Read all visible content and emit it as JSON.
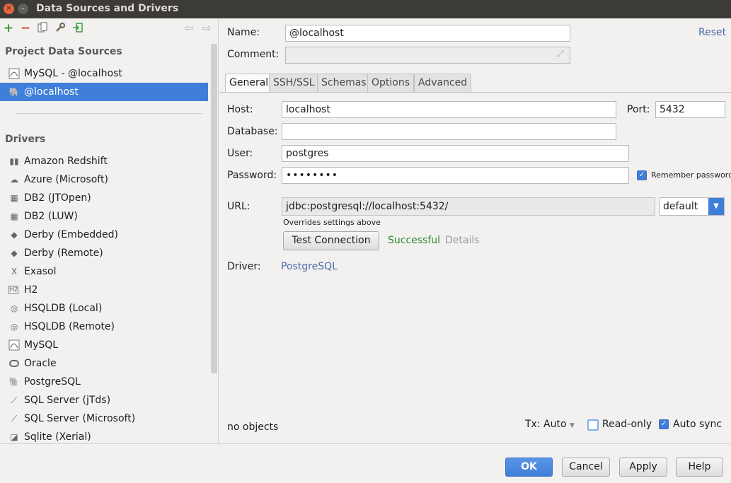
{
  "window": {
    "title": "Data Sources and Drivers"
  },
  "left": {
    "project_section": "Project Data Sources",
    "project_items": [
      {
        "label": "MySQL - @localhost",
        "icon": "mysql-icon"
      },
      {
        "label": "@localhost",
        "icon": "postgresql-icon",
        "selected": true
      }
    ],
    "drivers_section": "Drivers",
    "drivers": [
      {
        "label": "Amazon Redshift",
        "icon": "redshift-icon"
      },
      {
        "label": "Azure (Microsoft)",
        "icon": "azure-icon"
      },
      {
        "label": "DB2 (JTOpen)",
        "icon": "db2-icon"
      },
      {
        "label": "DB2 (LUW)",
        "icon": "db2-icon"
      },
      {
        "label": "Derby (Embedded)",
        "icon": "derby-icon"
      },
      {
        "label": "Derby (Remote)",
        "icon": "derby-icon"
      },
      {
        "label": "Exasol",
        "icon": "exasol-icon"
      },
      {
        "label": "H2",
        "icon": "h2-icon"
      },
      {
        "label": "HSQLDB (Local)",
        "icon": "hsqldb-icon"
      },
      {
        "label": "HSQLDB (Remote)",
        "icon": "hsqldb-icon"
      },
      {
        "label": "MySQL",
        "icon": "mysql-icon"
      },
      {
        "label": "Oracle",
        "icon": "oracle-icon"
      },
      {
        "label": "PostgreSQL",
        "icon": "postgresql-icon"
      },
      {
        "label": "SQL Server (jTds)",
        "icon": "sqlserver-icon"
      },
      {
        "label": "SQL Server (Microsoft)",
        "icon": "sqlserver-icon"
      },
      {
        "label": "Sqlite (Xerial)",
        "icon": "sqlite-icon"
      }
    ]
  },
  "form": {
    "name_label": "Name:",
    "name_value": "@localhost",
    "comment_label": "Comment:",
    "comment_value": "",
    "reset": "Reset",
    "tabs": [
      "General",
      "SSH/SSL",
      "Schemas",
      "Options",
      "Advanced"
    ],
    "active_tab": "General",
    "host_label": "Host:",
    "host_value": "localhost",
    "port_label": "Port:",
    "port_value": "5432",
    "database_label": "Database:",
    "database_value": "",
    "user_label": "User:",
    "user_value": "postgres",
    "password_label": "Password:",
    "password_value": "••••••••",
    "remember_password": "Remember password",
    "remember_checked": true,
    "url_label": "URL:",
    "url_value": "jdbc:postgresql://localhost:5432/",
    "url_mode": "default",
    "url_hint": "Overrides settings above",
    "test_connection": "Test Connection",
    "test_status": "Successful",
    "details": "Details",
    "driver_label": "Driver:",
    "driver_value": "PostgreSQL",
    "objects_status": "no objects",
    "tx": "Tx: Auto",
    "read_only": "Read-only",
    "read_only_checked": false,
    "auto_sync": "Auto sync",
    "auto_sync_checked": true
  },
  "buttons": {
    "ok": "OK",
    "cancel": "Cancel",
    "apply": "Apply",
    "help": "Help"
  },
  "colors": {
    "accent": "#3f7fd9",
    "success": "#2e8b2e",
    "link": "#4e6aa7",
    "titlebar": "#3c3b37",
    "close": "#e9643a"
  }
}
